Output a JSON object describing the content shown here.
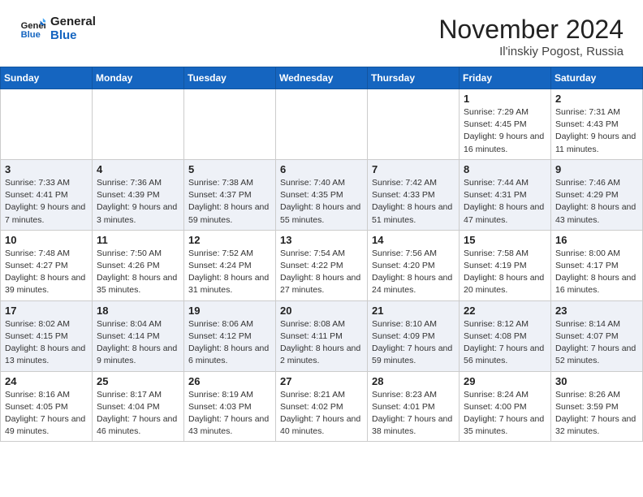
{
  "logo": {
    "line1": "General",
    "line2": "Blue"
  },
  "title": "November 2024",
  "subtitle": "Il'inskiy Pogost, Russia",
  "days_of_week": [
    "Sunday",
    "Monday",
    "Tuesday",
    "Wednesday",
    "Thursday",
    "Friday",
    "Saturday"
  ],
  "weeks": [
    [
      {
        "day": "",
        "info": ""
      },
      {
        "day": "",
        "info": ""
      },
      {
        "day": "",
        "info": ""
      },
      {
        "day": "",
        "info": ""
      },
      {
        "day": "",
        "info": ""
      },
      {
        "day": "1",
        "info": "Sunrise: 7:29 AM\nSunset: 4:45 PM\nDaylight: 9 hours and 16 minutes."
      },
      {
        "day": "2",
        "info": "Sunrise: 7:31 AM\nSunset: 4:43 PM\nDaylight: 9 hours and 11 minutes."
      }
    ],
    [
      {
        "day": "3",
        "info": "Sunrise: 7:33 AM\nSunset: 4:41 PM\nDaylight: 9 hours and 7 minutes."
      },
      {
        "day": "4",
        "info": "Sunrise: 7:36 AM\nSunset: 4:39 PM\nDaylight: 9 hours and 3 minutes."
      },
      {
        "day": "5",
        "info": "Sunrise: 7:38 AM\nSunset: 4:37 PM\nDaylight: 8 hours and 59 minutes."
      },
      {
        "day": "6",
        "info": "Sunrise: 7:40 AM\nSunset: 4:35 PM\nDaylight: 8 hours and 55 minutes."
      },
      {
        "day": "7",
        "info": "Sunrise: 7:42 AM\nSunset: 4:33 PM\nDaylight: 8 hours and 51 minutes."
      },
      {
        "day": "8",
        "info": "Sunrise: 7:44 AM\nSunset: 4:31 PM\nDaylight: 8 hours and 47 minutes."
      },
      {
        "day": "9",
        "info": "Sunrise: 7:46 AM\nSunset: 4:29 PM\nDaylight: 8 hours and 43 minutes."
      }
    ],
    [
      {
        "day": "10",
        "info": "Sunrise: 7:48 AM\nSunset: 4:27 PM\nDaylight: 8 hours and 39 minutes."
      },
      {
        "day": "11",
        "info": "Sunrise: 7:50 AM\nSunset: 4:26 PM\nDaylight: 8 hours and 35 minutes."
      },
      {
        "day": "12",
        "info": "Sunrise: 7:52 AM\nSunset: 4:24 PM\nDaylight: 8 hours and 31 minutes."
      },
      {
        "day": "13",
        "info": "Sunrise: 7:54 AM\nSunset: 4:22 PM\nDaylight: 8 hours and 27 minutes."
      },
      {
        "day": "14",
        "info": "Sunrise: 7:56 AM\nSunset: 4:20 PM\nDaylight: 8 hours and 24 minutes."
      },
      {
        "day": "15",
        "info": "Sunrise: 7:58 AM\nSunset: 4:19 PM\nDaylight: 8 hours and 20 minutes."
      },
      {
        "day": "16",
        "info": "Sunrise: 8:00 AM\nSunset: 4:17 PM\nDaylight: 8 hours and 16 minutes."
      }
    ],
    [
      {
        "day": "17",
        "info": "Sunrise: 8:02 AM\nSunset: 4:15 PM\nDaylight: 8 hours and 13 minutes."
      },
      {
        "day": "18",
        "info": "Sunrise: 8:04 AM\nSunset: 4:14 PM\nDaylight: 8 hours and 9 minutes."
      },
      {
        "day": "19",
        "info": "Sunrise: 8:06 AM\nSunset: 4:12 PM\nDaylight: 8 hours and 6 minutes."
      },
      {
        "day": "20",
        "info": "Sunrise: 8:08 AM\nSunset: 4:11 PM\nDaylight: 8 hours and 2 minutes."
      },
      {
        "day": "21",
        "info": "Sunrise: 8:10 AM\nSunset: 4:09 PM\nDaylight: 7 hours and 59 minutes."
      },
      {
        "day": "22",
        "info": "Sunrise: 8:12 AM\nSunset: 4:08 PM\nDaylight: 7 hours and 56 minutes."
      },
      {
        "day": "23",
        "info": "Sunrise: 8:14 AM\nSunset: 4:07 PM\nDaylight: 7 hours and 52 minutes."
      }
    ],
    [
      {
        "day": "24",
        "info": "Sunrise: 8:16 AM\nSunset: 4:05 PM\nDaylight: 7 hours and 49 minutes."
      },
      {
        "day": "25",
        "info": "Sunrise: 8:17 AM\nSunset: 4:04 PM\nDaylight: 7 hours and 46 minutes."
      },
      {
        "day": "26",
        "info": "Sunrise: 8:19 AM\nSunset: 4:03 PM\nDaylight: 7 hours and 43 minutes."
      },
      {
        "day": "27",
        "info": "Sunrise: 8:21 AM\nSunset: 4:02 PM\nDaylight: 7 hours and 40 minutes."
      },
      {
        "day": "28",
        "info": "Sunrise: 8:23 AM\nSunset: 4:01 PM\nDaylight: 7 hours and 38 minutes."
      },
      {
        "day": "29",
        "info": "Sunrise: 8:24 AM\nSunset: 4:00 PM\nDaylight: 7 hours and 35 minutes."
      },
      {
        "day": "30",
        "info": "Sunrise: 8:26 AM\nSunset: 3:59 PM\nDaylight: 7 hours and 32 minutes."
      }
    ]
  ]
}
